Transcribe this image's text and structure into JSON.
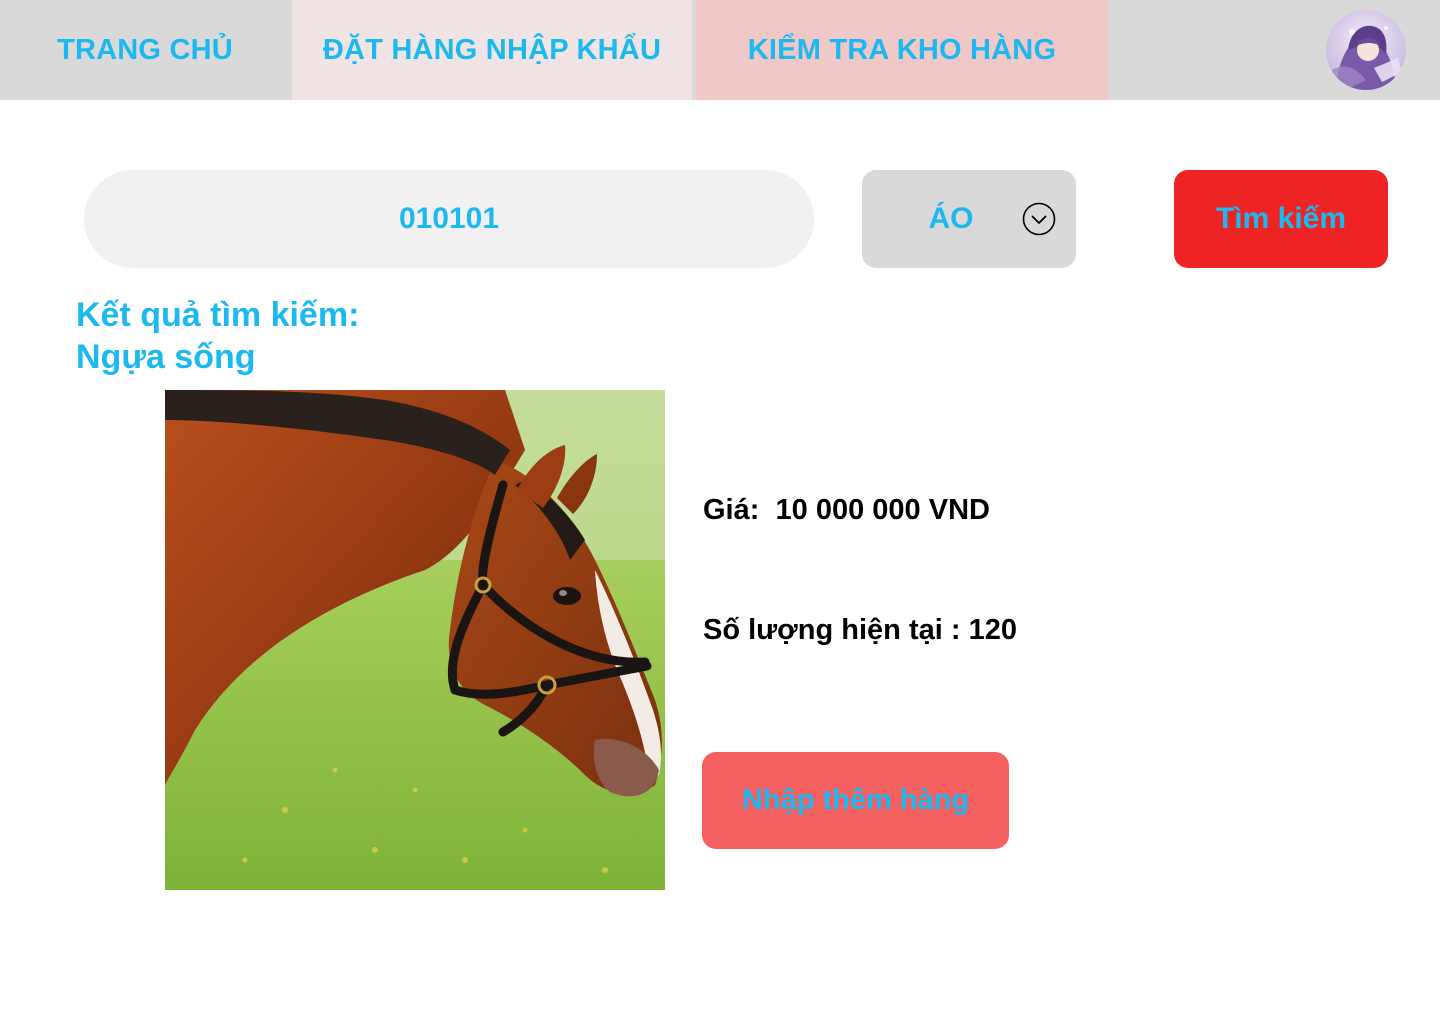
{
  "nav": {
    "tabs": [
      {
        "label": "TRANG CHỦ"
      },
      {
        "label": "ĐẶT HÀNG NHẬP KHẨU"
      },
      {
        "label": "KIỂM TRA KHO HÀNG"
      }
    ]
  },
  "search": {
    "value": "010101",
    "category": "ÁO",
    "button_label": "Tìm kiếm"
  },
  "results": {
    "heading": "Kết quả tìm kiếm:",
    "product_name": "Ngựa sống"
  },
  "product": {
    "price_label": "Giá:",
    "price_value": "10 000 000 VND",
    "qty_label": "Số lượng hiện tại :",
    "qty_value": "120",
    "restock_label": "Nhập thêm hàng"
  },
  "colors": {
    "accent_text": "#1cb8f0",
    "search_button": "#ee2424",
    "restock_button": "#f45f5f",
    "nav_bg": "#d9d9d9",
    "tab_order_bg": "#f0e4e4",
    "tab_stock_bg": "#f0c8c8"
  },
  "icons": {
    "category_dropdown": "chevron-down-icon",
    "avatar": "avatar"
  }
}
